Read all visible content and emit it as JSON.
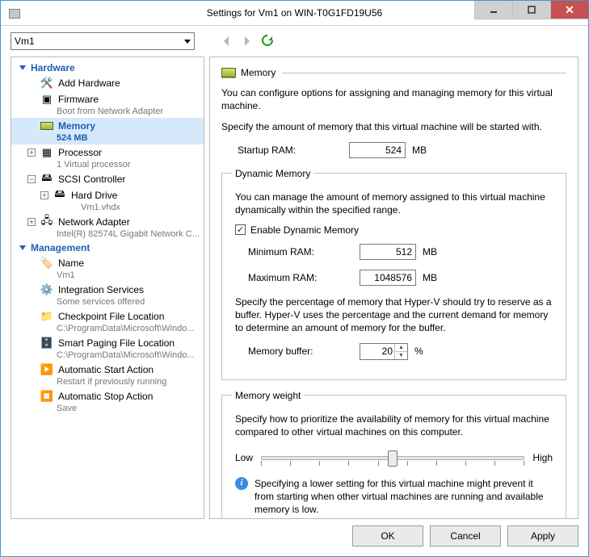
{
  "title": "Settings for Vm1 on WIN-T0G1FD19U56",
  "vm_select": "Vm1",
  "tree": {
    "hardware_label": "Hardware",
    "management_label": "Management",
    "add_hardware": "Add Hardware",
    "firmware": {
      "label": "Firmware",
      "sub": "Boot from Network Adapter"
    },
    "memory": {
      "label": "Memory",
      "sub": "524 MB"
    },
    "processor": {
      "label": "Processor",
      "sub": "1 Virtual processor"
    },
    "scsi": {
      "label": "SCSI Controller"
    },
    "hard_drive": {
      "label": "Hard Drive",
      "sub": "Vm1.vhdx"
    },
    "net": {
      "label": "Network Adapter",
      "sub": "Intel(R) 82574L Gigabit Network C..."
    },
    "name_item": {
      "label": "Name",
      "sub": "Vm1"
    },
    "integration": {
      "label": "Integration Services",
      "sub": "Some services offered"
    },
    "checkpoint": {
      "label": "Checkpoint File Location",
      "sub": "C:\\ProgramData\\Microsoft\\Windo..."
    },
    "smart_paging": {
      "label": "Smart Paging File Location",
      "sub": "C:\\ProgramData\\Microsoft\\Windo..."
    },
    "auto_start": {
      "label": "Automatic Start Action",
      "sub": "Restart if previously running"
    },
    "auto_stop": {
      "label": "Automatic Stop Action",
      "sub": "Save"
    }
  },
  "detail": {
    "header": "Memory",
    "desc": "You can configure options for assigning and managing memory for this virtual machine.",
    "startup_intro": "Specify the amount of memory that this virtual machine will be started with.",
    "startup_label": "Startup RAM:",
    "startup_value": "524",
    "mb": "MB",
    "dyn": {
      "legend": "Dynamic Memory",
      "desc": "You can manage the amount of memory assigned to this virtual machine dynamically within the specified range.",
      "enable_label": "Enable Dynamic Memory",
      "min_label": "Minimum RAM:",
      "min_value": "512",
      "max_label": "Maximum RAM:",
      "max_value": "1048576",
      "buffer_desc": "Specify the percentage of memory that Hyper-V should try to reserve as a buffer. Hyper-V uses the percentage and the current demand for memory to determine an amount of memory for the buffer.",
      "buffer_label": "Memory buffer:",
      "buffer_value": "20",
      "percent": "%"
    },
    "weight": {
      "legend": "Memory weight",
      "desc": "Specify how to prioritize the availability of memory for this virtual machine compared to other virtual machines on this computer.",
      "low": "Low",
      "high": "High",
      "info": "Specifying a lower setting for this virtual machine might prevent it from starting when other virtual machines are running and available memory is low."
    }
  },
  "buttons": {
    "ok": "OK",
    "cancel": "Cancel",
    "apply": "Apply"
  }
}
